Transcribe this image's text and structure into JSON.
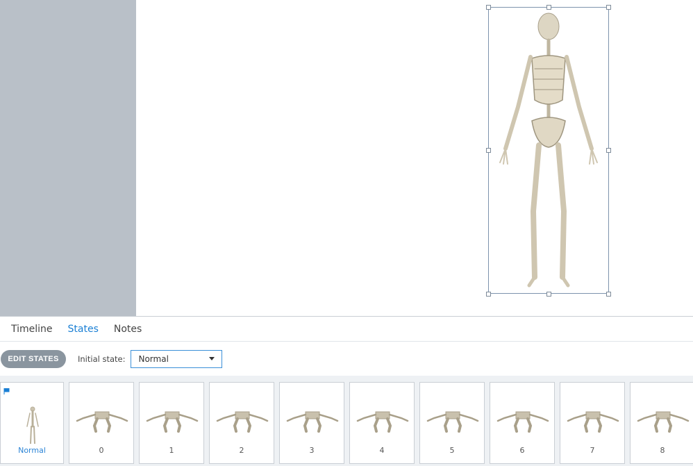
{
  "tabs": [
    {
      "label": "Timeline"
    },
    {
      "label": "States"
    },
    {
      "label": "Notes"
    }
  ],
  "active_tab": "States",
  "toolbar": {
    "edit_states": "EDIT STATES",
    "initial_state_label": "Initial state:",
    "initial_state_value": "Normal"
  },
  "states": [
    {
      "label": "Normal"
    },
    {
      "label": "0"
    },
    {
      "label": "1"
    },
    {
      "label": "2"
    },
    {
      "label": "3"
    },
    {
      "label": "4"
    },
    {
      "label": "5"
    },
    {
      "label": "6"
    },
    {
      "label": "7"
    },
    {
      "label": "8"
    }
  ],
  "colors": {
    "accent": "#1a7fd4",
    "bone": "#d8d0bc"
  }
}
